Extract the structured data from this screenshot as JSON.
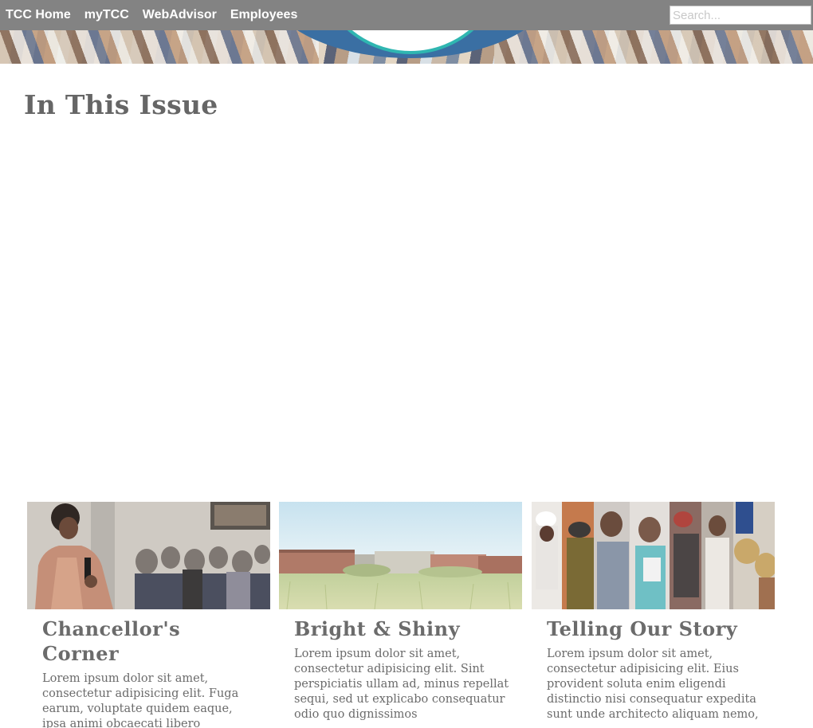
{
  "nav": {
    "links": [
      "TCC Home",
      "myTCC",
      "WebAdvisor",
      "Employees"
    ],
    "search_placeholder": "Search..."
  },
  "main": {
    "heading": "In This Issue"
  },
  "cards": [
    {
      "title": "Chancellor's Corner",
      "body": "Lorem ipsum dolor sit amet, consectetur adipisicing elit. Fuga earum, voluptate quidem eaque, ipsa animi obcaecati libero"
    },
    {
      "title": "Bright & Shiny",
      "body": "Lorem ipsum dolor sit amet, consectetur adipisicing elit. Sint perspiciatis ullam ad, minus repellat sequi, sed ut explicabo consequatur odio quo dignissimos"
    },
    {
      "title": "Telling Our Story",
      "body": "Lorem ipsum dolor sit amet, consectetur adipisicing elit. Eius provident soluta enim eligendi distinctio nisi consequatur expedita sunt unde architecto aliquam nemo,"
    }
  ],
  "colors": {
    "nav_bar": "#838383",
    "heading_text": "#666666",
    "seal_ring": "#2fb6b1"
  }
}
